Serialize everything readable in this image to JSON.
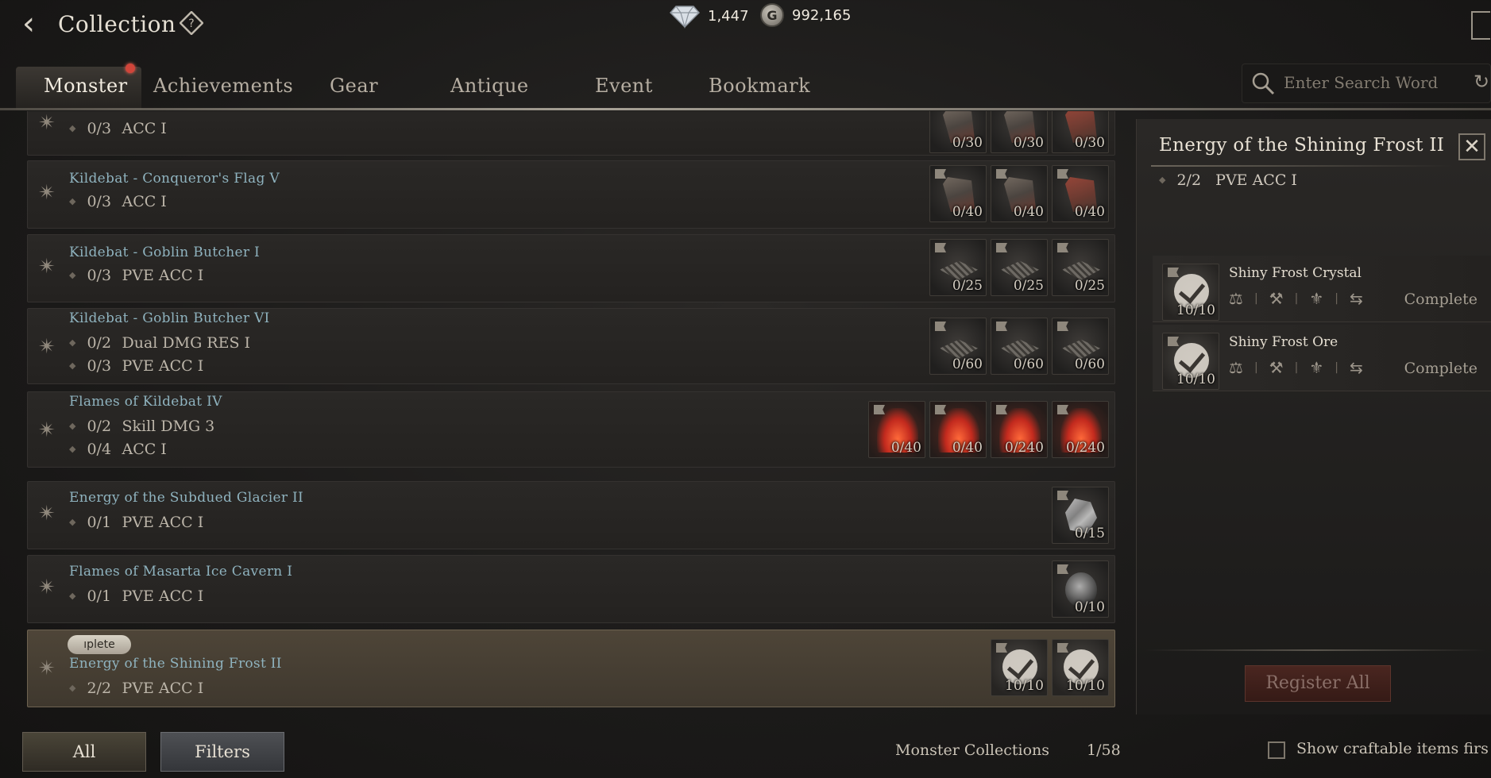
{
  "header": {
    "title": "Collection",
    "diamonds": "1,447",
    "gold": "992,165",
    "gold_symbol": "G"
  },
  "tabs": [
    {
      "label": "Monster",
      "active": true
    },
    {
      "label": "Achievements"
    },
    {
      "label": "Gear"
    },
    {
      "label": "Antique"
    },
    {
      "label": "Event"
    },
    {
      "label": "Bookmark"
    }
  ],
  "search": {
    "placeholder": "Enter Search Word"
  },
  "collections": [
    {
      "name": "",
      "stats": [
        {
          "progress": "0/3",
          "label": "ACC I"
        }
      ],
      "items": [
        {
          "type": "flag",
          "count": "0/30"
        },
        {
          "type": "flag",
          "count": "0/30"
        },
        {
          "type": "flag-red",
          "count": "0/30"
        }
      ]
    },
    {
      "name": "Kildebat - Conqueror's Flag V",
      "stats": [
        {
          "progress": "0/3",
          "label": "ACC I"
        }
      ],
      "items": [
        {
          "type": "flag",
          "count": "0/40"
        },
        {
          "type": "flag",
          "count": "0/40"
        },
        {
          "type": "flag-red",
          "count": "0/40"
        }
      ]
    },
    {
      "name": "Kildebat - Goblin Butcher I",
      "stats": [
        {
          "progress": "0/3",
          "label": "PVE ACC I"
        }
      ],
      "items": [
        {
          "type": "tray",
          "count": "0/25"
        },
        {
          "type": "tray",
          "count": "0/25"
        },
        {
          "type": "tray",
          "count": "0/25"
        }
      ]
    },
    {
      "name": "Kildebat - Goblin Butcher VI",
      "stats": [
        {
          "progress": "0/2",
          "label": "Dual DMG RES I"
        },
        {
          "progress": "0/3",
          "label": "PVE ACC I"
        }
      ],
      "items": [
        {
          "type": "tray",
          "count": "0/60"
        },
        {
          "type": "tray",
          "count": "0/60"
        },
        {
          "type": "tray",
          "count": "0/60"
        }
      ]
    },
    {
      "name": "Flames of Kildebat IV",
      "stats": [
        {
          "progress": "0/2",
          "label": "Skill DMG 3"
        },
        {
          "progress": "0/4",
          "label": "ACC I"
        }
      ],
      "items": [
        {
          "type": "fire",
          "count": "0/40"
        },
        {
          "type": "fire",
          "count": "0/40"
        },
        {
          "type": "fire",
          "count": "0/240"
        },
        {
          "type": "fire",
          "count": "0/240"
        }
      ]
    },
    {
      "name": "Energy of the Subdued Glacier II",
      "stats": [
        {
          "progress": "0/1",
          "label": "PVE ACC I"
        }
      ],
      "items": [
        {
          "type": "crystal",
          "count": "0/15"
        }
      ]
    },
    {
      "name": "Flames of Masarta Ice Cavern I",
      "stats": [
        {
          "progress": "0/1",
          "label": "PVE ACC I"
        }
      ],
      "items": [
        {
          "type": "ore",
          "count": "0/10"
        }
      ]
    },
    {
      "name": "Energy of the Shining Frost II",
      "badge": "ıplete",
      "stats": [
        {
          "progress": "2/2",
          "label": "PVE ACC I"
        }
      ],
      "items": [
        {
          "type": "done",
          "count": "10/10"
        },
        {
          "type": "done",
          "count": "10/10"
        }
      ]
    }
  ],
  "detail": {
    "title": "Energy of the Shining Frost II",
    "stat_progress": "2/2",
    "stat_label": "PVE ACC I",
    "materials": [
      {
        "name": "Shiny Frost Crystal",
        "count": "10/10",
        "status": "Complete"
      },
      {
        "name": "Shiny Frost Ore",
        "count": "10/10",
        "status": "Complete"
      }
    ],
    "register_label": "Register All"
  },
  "footer": {
    "all_label": "All",
    "filters_label": "Filters",
    "count_label": "Monster Collections",
    "count_value": "1/58",
    "craftable_label": "Show craftable items firs"
  }
}
